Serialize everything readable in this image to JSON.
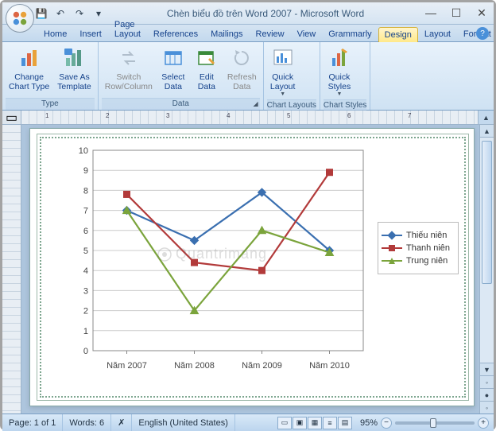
{
  "window": {
    "title": "Chèn biểu đồ trên Word 2007 - Microsoft Word",
    "qat": {
      "save": "💾",
      "undo": "↶",
      "redo": "↷"
    },
    "controls": {
      "min": "—",
      "max": "☐",
      "close": "✕"
    }
  },
  "tabs": {
    "items": [
      "Home",
      "Insert",
      "Page Layout",
      "References",
      "Mailings",
      "Review",
      "View",
      "Grammarly",
      "Design",
      "Layout",
      "Format"
    ],
    "active": "Design",
    "help": "?"
  },
  "ribbon": {
    "type": {
      "label": "Type",
      "change_chart": "Change\nChart Type",
      "save_template": "Save As\nTemplate"
    },
    "data": {
      "label": "Data",
      "switch": "Switch\nRow/Column",
      "select": "Select\nData",
      "edit": "Edit\nData",
      "refresh": "Refresh\nData"
    },
    "layouts": {
      "label": "Chart Layouts",
      "quick_layout": "Quick\nLayout"
    },
    "styles": {
      "label": "Chart Styles",
      "quick_styles": "Quick\nStyles"
    }
  },
  "ruler": {
    "nums": [
      "1",
      "2",
      "3",
      "4",
      "5",
      "6",
      "7"
    ]
  },
  "chart_data": {
    "type": "line",
    "categories": [
      "Năm 2007",
      "Năm 2008",
      "Năm 2009",
      "Năm 2010"
    ],
    "series": [
      {
        "name": "Thiếu niên",
        "color": "#3a6fb0",
        "marker": "diamond",
        "values": [
          7.0,
          5.5,
          7.9,
          5.0
        ]
      },
      {
        "name": "Thanh niên",
        "color": "#b23a3a",
        "marker": "square",
        "values": [
          7.8,
          4.4,
          4.0,
          8.9
        ]
      },
      {
        "name": "Trung niên",
        "color": "#7ba43c",
        "marker": "triangle",
        "values": [
          7.0,
          2.0,
          6.0,
          4.9
        ]
      }
    ],
    "ylim": [
      0,
      10
    ],
    "yticks": [
      0,
      1,
      2,
      3,
      4,
      5,
      6,
      7,
      8,
      9,
      10
    ]
  },
  "status": {
    "page": "Page: 1 of 1",
    "words": "Words: 6",
    "lang": "English (United States)",
    "zoom": "95%"
  },
  "watermark": "Quantrimang"
}
